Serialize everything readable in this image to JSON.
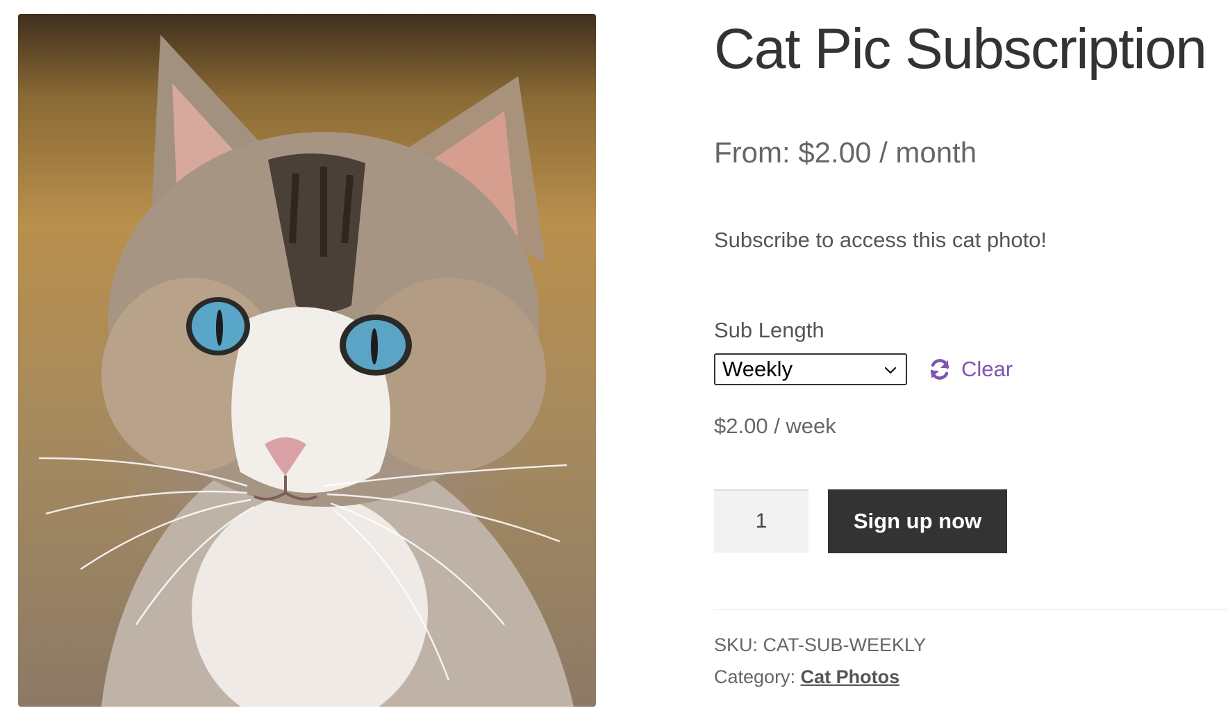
{
  "product": {
    "title": "Cat Pic Subscription",
    "price_range": "From: $2.00 / month",
    "short_description": "Subscribe to access this cat photo!",
    "image_subject": "cat-photo"
  },
  "variations": {
    "label": "Sub Length",
    "selected": "Weekly",
    "options": [
      "Weekly"
    ],
    "clear_label": "Clear",
    "clear_icon": "refresh-icon",
    "price": "$2.00 / week"
  },
  "cart": {
    "quantity": "1",
    "button_label": "Sign up now"
  },
  "meta": {
    "sku_label": "SKU:",
    "sku_value": "CAT-SUB-WEEKLY",
    "category_label": "Category:",
    "category_value": "Cat Photos"
  },
  "colors": {
    "accent": "#7f54b3",
    "button_bg": "#333333",
    "text": "#333333"
  }
}
